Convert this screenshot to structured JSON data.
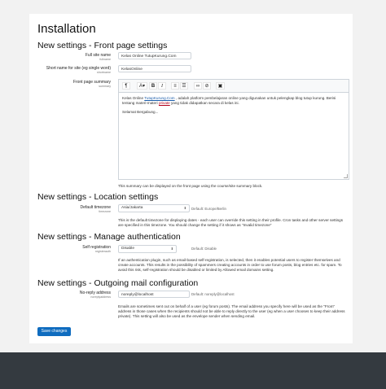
{
  "title": "Installation",
  "sections": {
    "front": "New settings - Front page settings",
    "location": "New settings - Location settings",
    "auth": "New settings - Manage authentication",
    "mail": "New settings - Outgoing mail configuration"
  },
  "fullname": {
    "label": "Full site name",
    "key": "fullname",
    "value": "Kelas Online TutupKurung.Com"
  },
  "shortname": {
    "label": "Short name for site (eg single word)",
    "key": "shortname",
    "value": "KelasOnline"
  },
  "summary": {
    "label": "Front page summary",
    "key": "summary",
    "toolbar": {
      "bold": "B",
      "italic": "I"
    },
    "content_pre": "Kelas Online ",
    "content_link": "TutupKurung.Com",
    "content_mid": " , adalah platform pembelajaran online yang digunakan untuk pelengkap blog tutup kurung. Berisi tentang materi-materi ",
    "content_private": "private",
    "content_post": " yang tidak didapatkan secara di kelas ini.",
    "content_greeting": "Selamat Bergabung...",
    "desc": "This summary can be displayed on the front page using the course/site summary block."
  },
  "timezone": {
    "label": "Default timezone",
    "key": "timezone",
    "value": "Asia/Jakarta",
    "default": "Default: Europe/Berlin",
    "desc": "This is the default timezone for displaying dates - each user can override this setting in their profile. Cron tasks and other server settings are specified in this timezone. You should change the setting if it shows as \"Invalid timezone\""
  },
  "registerauth": {
    "label": "Self registration",
    "key": "registerauth",
    "value": "Disable",
    "default": "Default: Disable",
    "desc": "If an authentication plugin, such as email-based self-registration, is selected, then it enables potential users to register themselves and create accounts. This results in the possibility of spammers creating accounts in order to use forum posts, blog entries etc. for spam. To avoid this risk, self-registration should be disabled or limited by Allowed email domains setting."
  },
  "noreply": {
    "label": "No-reply address",
    "key": "noreplyaddress",
    "value": "noreply@localhost",
    "default": "Default: noreply@localhost",
    "desc": "Emails are sometimes sent out on behalf of a user (eg forum posts). The email address you specify here will be used as the \"From\" address in those cases when the recipients should not be able to reply directly to the user (eg when a user chooses to keep their address private). This setting will also be used as the envelope sender when sending email."
  },
  "save_button": "Save changes"
}
